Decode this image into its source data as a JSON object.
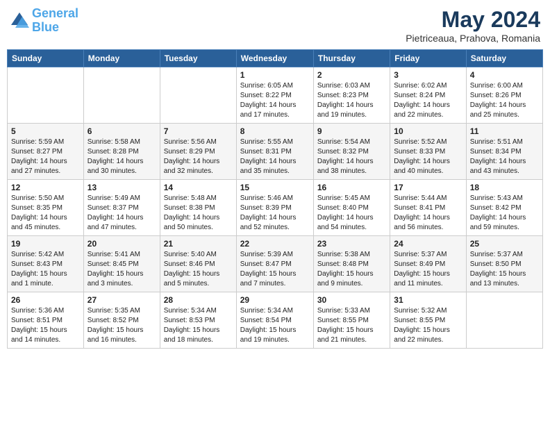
{
  "logo": {
    "line1": "General",
    "line2": "Blue"
  },
  "title": "May 2024",
  "subtitle": "Pietriceaua, Prahova, Romania",
  "weekdays": [
    "Sunday",
    "Monday",
    "Tuesday",
    "Wednesday",
    "Thursday",
    "Friday",
    "Saturday"
  ],
  "weeks": [
    [
      {
        "day": "",
        "info": ""
      },
      {
        "day": "",
        "info": ""
      },
      {
        "day": "",
        "info": ""
      },
      {
        "day": "1",
        "info": "Sunrise: 6:05 AM\nSunset: 8:22 PM\nDaylight: 14 hours\nand 17 minutes."
      },
      {
        "day": "2",
        "info": "Sunrise: 6:03 AM\nSunset: 8:23 PM\nDaylight: 14 hours\nand 19 minutes."
      },
      {
        "day": "3",
        "info": "Sunrise: 6:02 AM\nSunset: 8:24 PM\nDaylight: 14 hours\nand 22 minutes."
      },
      {
        "day": "4",
        "info": "Sunrise: 6:00 AM\nSunset: 8:26 PM\nDaylight: 14 hours\nand 25 minutes."
      }
    ],
    [
      {
        "day": "5",
        "info": "Sunrise: 5:59 AM\nSunset: 8:27 PM\nDaylight: 14 hours\nand 27 minutes."
      },
      {
        "day": "6",
        "info": "Sunrise: 5:58 AM\nSunset: 8:28 PM\nDaylight: 14 hours\nand 30 minutes."
      },
      {
        "day": "7",
        "info": "Sunrise: 5:56 AM\nSunset: 8:29 PM\nDaylight: 14 hours\nand 32 minutes."
      },
      {
        "day": "8",
        "info": "Sunrise: 5:55 AM\nSunset: 8:31 PM\nDaylight: 14 hours\nand 35 minutes."
      },
      {
        "day": "9",
        "info": "Sunrise: 5:54 AM\nSunset: 8:32 PM\nDaylight: 14 hours\nand 38 minutes."
      },
      {
        "day": "10",
        "info": "Sunrise: 5:52 AM\nSunset: 8:33 PM\nDaylight: 14 hours\nand 40 minutes."
      },
      {
        "day": "11",
        "info": "Sunrise: 5:51 AM\nSunset: 8:34 PM\nDaylight: 14 hours\nand 43 minutes."
      }
    ],
    [
      {
        "day": "12",
        "info": "Sunrise: 5:50 AM\nSunset: 8:35 PM\nDaylight: 14 hours\nand 45 minutes."
      },
      {
        "day": "13",
        "info": "Sunrise: 5:49 AM\nSunset: 8:37 PM\nDaylight: 14 hours\nand 47 minutes."
      },
      {
        "day": "14",
        "info": "Sunrise: 5:48 AM\nSunset: 8:38 PM\nDaylight: 14 hours\nand 50 minutes."
      },
      {
        "day": "15",
        "info": "Sunrise: 5:46 AM\nSunset: 8:39 PM\nDaylight: 14 hours\nand 52 minutes."
      },
      {
        "day": "16",
        "info": "Sunrise: 5:45 AM\nSunset: 8:40 PM\nDaylight: 14 hours\nand 54 minutes."
      },
      {
        "day": "17",
        "info": "Sunrise: 5:44 AM\nSunset: 8:41 PM\nDaylight: 14 hours\nand 56 minutes."
      },
      {
        "day": "18",
        "info": "Sunrise: 5:43 AM\nSunset: 8:42 PM\nDaylight: 14 hours\nand 59 minutes."
      }
    ],
    [
      {
        "day": "19",
        "info": "Sunrise: 5:42 AM\nSunset: 8:43 PM\nDaylight: 15 hours\nand 1 minute."
      },
      {
        "day": "20",
        "info": "Sunrise: 5:41 AM\nSunset: 8:45 PM\nDaylight: 15 hours\nand 3 minutes."
      },
      {
        "day": "21",
        "info": "Sunrise: 5:40 AM\nSunset: 8:46 PM\nDaylight: 15 hours\nand 5 minutes."
      },
      {
        "day": "22",
        "info": "Sunrise: 5:39 AM\nSunset: 8:47 PM\nDaylight: 15 hours\nand 7 minutes."
      },
      {
        "day": "23",
        "info": "Sunrise: 5:38 AM\nSunset: 8:48 PM\nDaylight: 15 hours\nand 9 minutes."
      },
      {
        "day": "24",
        "info": "Sunrise: 5:37 AM\nSunset: 8:49 PM\nDaylight: 15 hours\nand 11 minutes."
      },
      {
        "day": "25",
        "info": "Sunrise: 5:37 AM\nSunset: 8:50 PM\nDaylight: 15 hours\nand 13 minutes."
      }
    ],
    [
      {
        "day": "26",
        "info": "Sunrise: 5:36 AM\nSunset: 8:51 PM\nDaylight: 15 hours\nand 14 minutes."
      },
      {
        "day": "27",
        "info": "Sunrise: 5:35 AM\nSunset: 8:52 PM\nDaylight: 15 hours\nand 16 minutes."
      },
      {
        "day": "28",
        "info": "Sunrise: 5:34 AM\nSunset: 8:53 PM\nDaylight: 15 hours\nand 18 minutes."
      },
      {
        "day": "29",
        "info": "Sunrise: 5:34 AM\nSunset: 8:54 PM\nDaylight: 15 hours\nand 19 minutes."
      },
      {
        "day": "30",
        "info": "Sunrise: 5:33 AM\nSunset: 8:55 PM\nDaylight: 15 hours\nand 21 minutes."
      },
      {
        "day": "31",
        "info": "Sunrise: 5:32 AM\nSunset: 8:55 PM\nDaylight: 15 hours\nand 22 minutes."
      },
      {
        "day": "",
        "info": ""
      }
    ]
  ]
}
